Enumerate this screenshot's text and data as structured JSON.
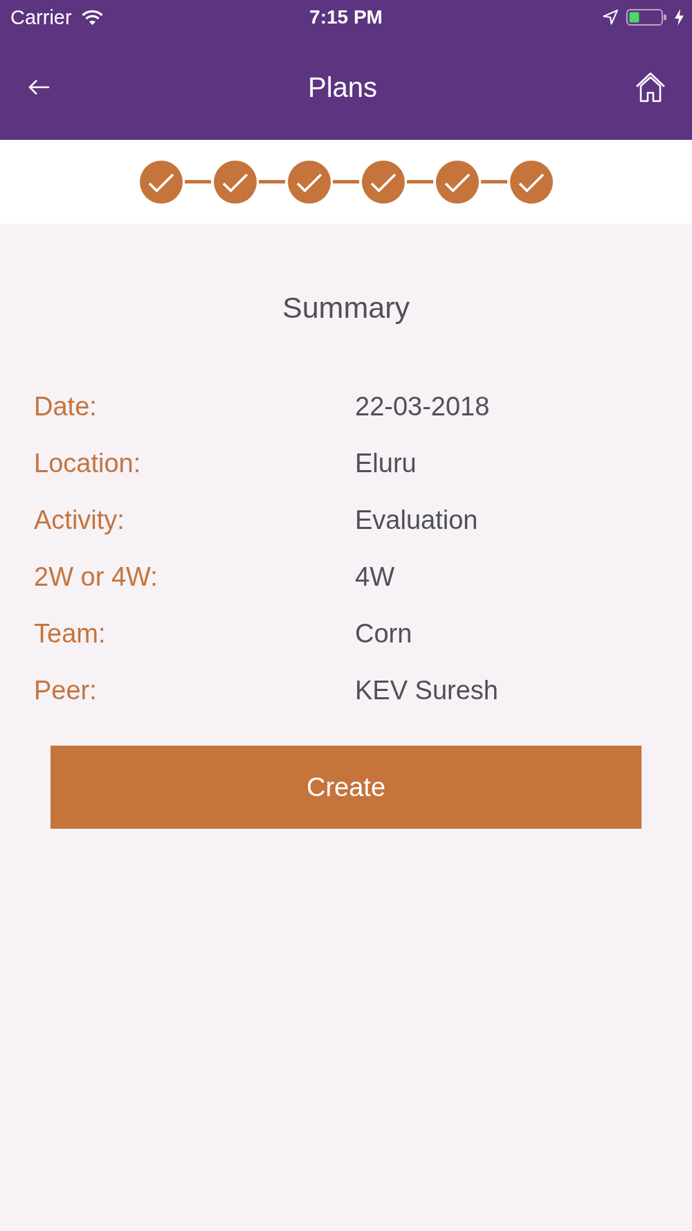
{
  "status_bar": {
    "carrier": "Carrier",
    "time": "7:15 PM"
  },
  "nav_bar": {
    "title": "Plans"
  },
  "stepper": {
    "steps": [
      {
        "completed": true
      },
      {
        "completed": true
      },
      {
        "completed": true
      },
      {
        "completed": true
      },
      {
        "completed": true
      },
      {
        "completed": true
      }
    ]
  },
  "summary": {
    "title": "Summary",
    "rows": [
      {
        "label": "Date:",
        "value": "22-03-2018"
      },
      {
        "label": "Location:",
        "value": "Eluru"
      },
      {
        "label": "Activity:",
        "value": "Evaluation"
      },
      {
        "label": "2W or 4W:",
        "value": "4W"
      },
      {
        "label": "Team:",
        "value": "Corn"
      },
      {
        "label": "Peer:",
        "value": "KEV Suresh"
      }
    ]
  },
  "create_button": {
    "label": "Create"
  }
}
